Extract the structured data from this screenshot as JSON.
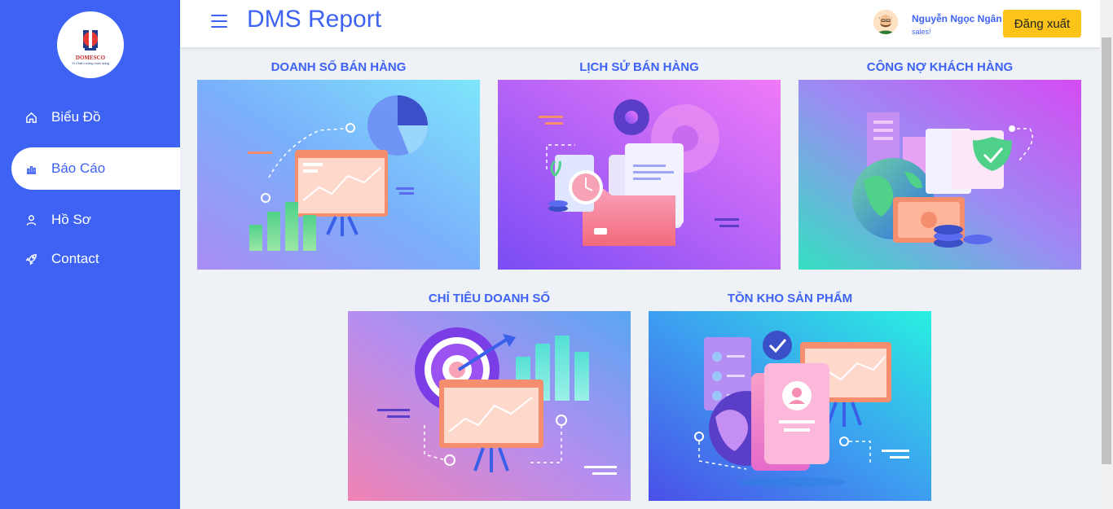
{
  "app": {
    "logo_brand": "DOMESCO",
    "logo_slogan": "Vì Chất Lượng cuộc sống"
  },
  "header": {
    "title": "DMS Report",
    "user_name": "Nguyễn Ngọc Ngân",
    "user_role": "sales!",
    "logout_label": "Đăng xuất"
  },
  "sidebar": {
    "items": [
      {
        "label": "Biểu Đồ",
        "icon": "home-icon"
      },
      {
        "label": "Báo Cáo",
        "icon": "bar-chart-icon",
        "active": true
      },
      {
        "label": "Hồ Sơ",
        "icon": "user-icon"
      },
      {
        "label": "Contact",
        "icon": "rocket-icon"
      }
    ]
  },
  "reports": [
    {
      "title": "DOANH SỐ BÁN HÀNG"
    },
    {
      "title": "LỊCH SỬ BÁN HÀNG"
    },
    {
      "title": "CÔNG NỢ KHÁCH HÀNG"
    },
    {
      "title": "CHỈ TIÊU DOANH SỐ"
    },
    {
      "title": "TỒN KHO SẢN PHẨM"
    }
  ],
  "colors": {
    "primary": "#3e63f4",
    "logout_button": "#fcc419"
  }
}
